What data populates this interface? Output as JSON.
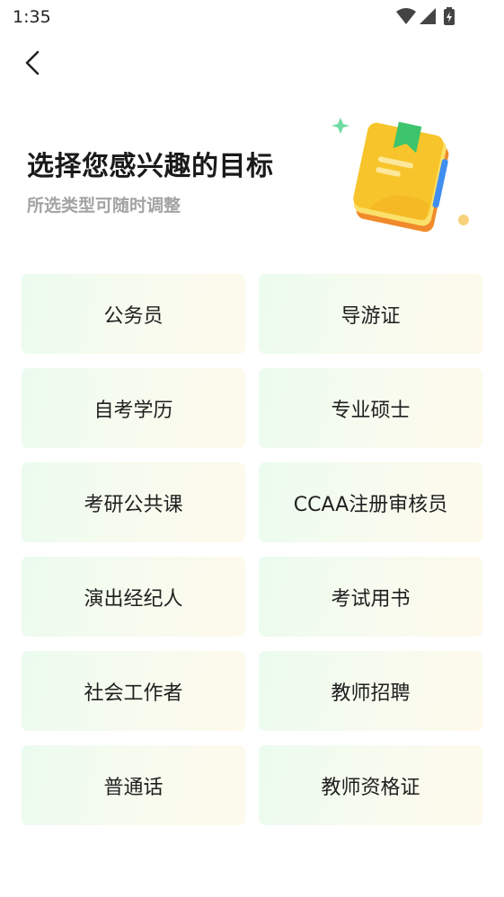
{
  "status_bar": {
    "time": "1:35",
    "icons": [
      "wifi-icon",
      "signal-icon",
      "battery-charging-icon"
    ]
  },
  "header": {
    "back_icon": "chevron-left-icon"
  },
  "hero": {
    "title": "选择您感兴趣的目标",
    "subtitle": "所选类型可随时调整",
    "illustration": "book-icon"
  },
  "colors": {
    "tile_start": "#ecfbef",
    "tile_end": "#fdfaec",
    "book_yellow": "#f7c52b",
    "bookmark_green": "#3dc46d"
  },
  "categories": [
    {
      "label": "公务员"
    },
    {
      "label": "导游证"
    },
    {
      "label": "自考学历"
    },
    {
      "label": "专业硕士"
    },
    {
      "label": "考研公共课"
    },
    {
      "label": "CCAA注册审核员"
    },
    {
      "label": "演出经纪人"
    },
    {
      "label": "考试用书"
    },
    {
      "label": "社会工作者"
    },
    {
      "label": "教师招聘"
    },
    {
      "label": "普通话"
    },
    {
      "label": "教师资格证"
    }
  ]
}
